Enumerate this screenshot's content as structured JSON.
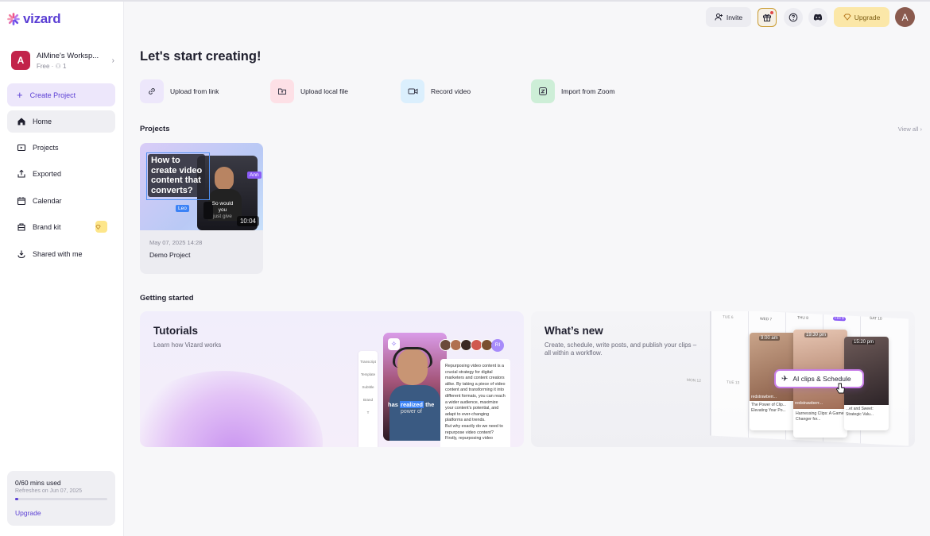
{
  "app": {
    "logo": "vizard"
  },
  "workspace": {
    "avatar": "A",
    "name": "AlMine's Worksp...",
    "plan": "Free · ",
    "members": "1"
  },
  "sidebar": {
    "create": "Create Project",
    "items": [
      {
        "label": "Home",
        "icon": "home-icon"
      },
      {
        "label": "Projects",
        "icon": "projects-icon"
      },
      {
        "label": "Exported",
        "icon": "export-icon"
      },
      {
        "label": "Calendar",
        "icon": "calendar-icon"
      },
      {
        "label": "Brand kit",
        "icon": "brand-icon"
      },
      {
        "label": "Shared with me",
        "icon": "shared-icon"
      }
    ]
  },
  "usage": {
    "used": "0/60 mins used",
    "refresh": "Refreshes on Jun 07, 2025",
    "upgrade": "Upgrade",
    "fraction": 0.02
  },
  "topbar": {
    "invite": "Invite",
    "upgrade": "Upgrade",
    "avatar": "A"
  },
  "main": {
    "title": "Let's start creating!",
    "actions": [
      {
        "label": "Upload from link",
        "icon": "link-icon",
        "color": "#ede7fb"
      },
      {
        "label": "Upload local file",
        "icon": "folder-icon",
        "color": "#fde0e6"
      },
      {
        "label": "Record video",
        "icon": "video-icon",
        "color": "#dbeffd"
      },
      {
        "label": "Import from Zoom",
        "icon": "zoom-icon",
        "color": "#cdeed7"
      }
    ],
    "projects_heading": "Projects",
    "view_all": "View all",
    "project": {
      "date": "May 07, 2025 14:28",
      "name": "Demo Project",
      "duration": "10:04",
      "thumb_lines": [
        "How to",
        "create video",
        "content that",
        "converts?"
      ],
      "tag_ann": "Ann",
      "tag_leo": "Leo",
      "caption1": "So would you",
      "caption2": "just give"
    },
    "getting_started": "Getting started",
    "tutorials": {
      "title": "Tutorials",
      "sub": "Learn how Vizard works",
      "caption_a": "has",
      "caption_b": "realized",
      "caption_c": "the",
      "caption_d": "power of",
      "tools": [
        "Transcript",
        "Template",
        "Subtitle",
        "Brand"
      ],
      "avatar_more": "RI",
      "doc": "Repurposing video content is a crucial strategy for digital marketers and content creators alike. By taking a piece of video content and transforming it into different formats, you can reach a wider audience, maximize your content's potential, and adapt to ever-changing platforms and trends.\nBut why exactly do we need to repurpose video content? Firstly, repurposing video"
    },
    "whatsnew": {
      "title": "What’s new",
      "sub1": "Create, schedule, write posts, and publish your clips –",
      "sub2": "all within a workflow.",
      "chip": "AI clips & Schedule",
      "days": [
        "TUE 6",
        "WED 7",
        "THU 8",
        "FRI 9",
        "SAT 10",
        "MON 12",
        "TUE 13"
      ],
      "times": [
        "9:00 am",
        "19:30 pm",
        "15:20 pm"
      ],
      "handle": "redstrawberr...",
      "handle2": "redstrawberr...",
      "posts": [
        "The Power of Clip... Elevating Your Po...",
        "Harnessing Clips: A Game Changer for...",
        "...et and Sweet: Strategic Valu..."
      ]
    }
  }
}
